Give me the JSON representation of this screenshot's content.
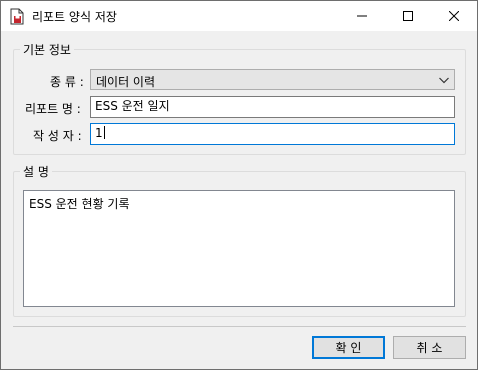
{
  "window": {
    "title": "리포트 양식 저장"
  },
  "basic_info": {
    "group_title": "기본 정보",
    "type_label": "종 류 :",
    "type_value": "데이터 이력",
    "name_label": "리포트 명 :",
    "name_value": "ESS 운전 일지",
    "author_label": "작 성 자 :",
    "author_value": "1"
  },
  "description": {
    "group_title": "설 명",
    "text": "ESS 운전 현황 기록"
  },
  "buttons": {
    "ok_label": "확 인",
    "cancel_label": "취 소"
  },
  "icons": {
    "app": "report-save-icon",
    "minimize": "minimize-icon",
    "maximize": "maximize-icon",
    "close": "close-icon",
    "dropdown": "chevron-down-icon"
  },
  "colors": {
    "accent": "#0078d7",
    "icon_red": "#c4262e"
  }
}
